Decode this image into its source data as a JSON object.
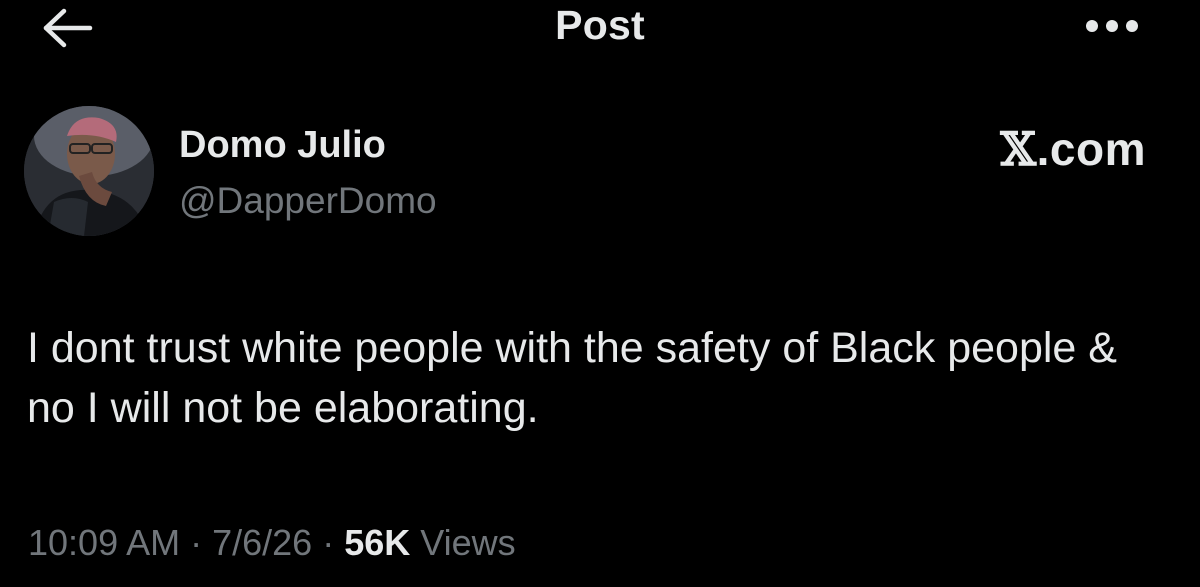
{
  "header": {
    "back_icon": "arrow-left-icon",
    "title": "Post",
    "more_icon": "more-horizontal-icon"
  },
  "author": {
    "display_name": "Domo Julio",
    "handle": "@DapperDomo",
    "avatar_icon": "profile-photo"
  },
  "brand": {
    "x_letter": "𝕏",
    "suffix": ".com"
  },
  "post": {
    "text": "I dont trust white people with the safety of Black people & no I will not be elaborating."
  },
  "meta": {
    "time": "10:09 AM",
    "separator": " · ",
    "date": "7/6/26",
    "views_count": "56K",
    "views_label": "Views"
  },
  "colors": {
    "background": "#000000",
    "primary_text": "#e7e9ea",
    "secondary_text": "#71767b"
  }
}
